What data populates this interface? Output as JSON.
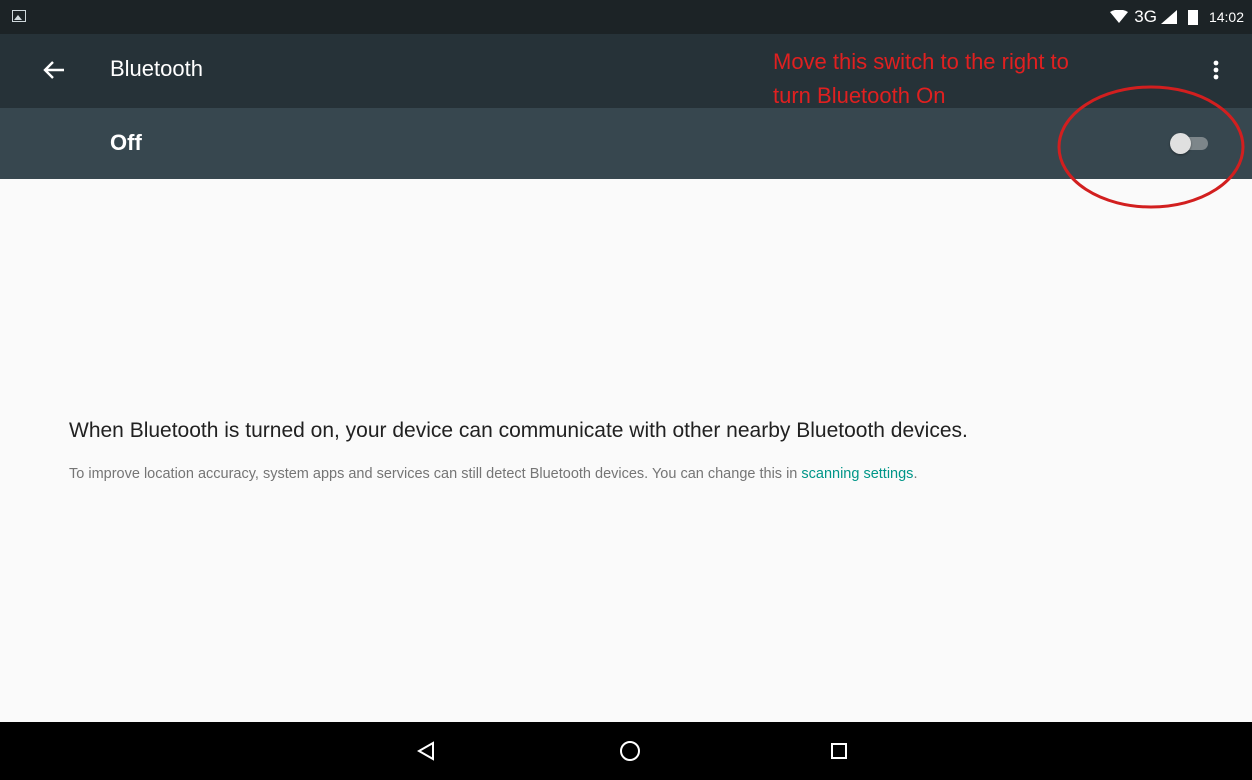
{
  "status_bar": {
    "network": "3G",
    "time": "14:02",
    "icons": [
      "image-notification-icon",
      "wifi-icon",
      "signal-icon",
      "battery-icon"
    ]
  },
  "app_bar": {
    "title": "Bluetooth",
    "back_icon": "arrow-back-icon",
    "menu_icon": "more-vert-icon"
  },
  "master_switch": {
    "label": "Off",
    "checked": false
  },
  "annotation": {
    "text": "Move this switch to the right to turn Bluetooth On",
    "color": "#e02020"
  },
  "content": {
    "description": "When Bluetooth is turned on, your device can communicate with other nearby Bluetooth devices.",
    "scan_note_prefix": "To improve location accuracy, system apps and services can still detect Bluetooth devices. You can change this in ",
    "scan_link": "scanning settings",
    "scan_note_suffix": "."
  },
  "nav_bar": {
    "buttons": [
      "back-triangle-icon",
      "home-circle-icon",
      "recents-square-icon"
    ]
  },
  "colors": {
    "status_bar": "#1c2326",
    "app_bar": "#263238",
    "switch_row": "#37474f",
    "link": "#009688",
    "annotation": "#e02020"
  }
}
